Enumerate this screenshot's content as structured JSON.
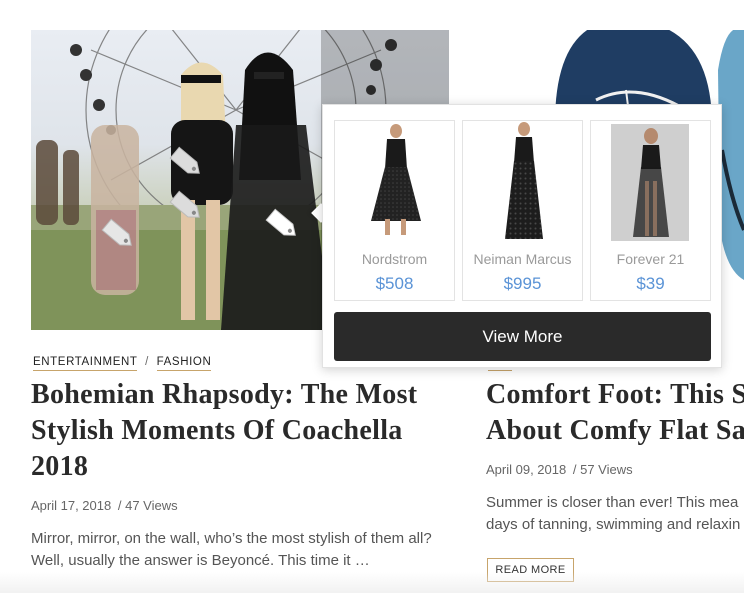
{
  "left_article": {
    "categories": [
      "ENTERTAINMENT",
      "FASHION"
    ],
    "category_separator": "/",
    "title": "Bohemian Rhapsody: The Most Stylish Moments Of Coachella 2018",
    "date": "April 17, 2018",
    "views": "/ 47 Views",
    "excerpt": "Mirror, mirror, on the wall, who’s the most stylish of them all? Well, usually the answer is Beyoncé. This time it …"
  },
  "right_article": {
    "title": "Comfort Foot: This S",
    "title_line2": "About Comfy Flat Sa",
    "date": "April 09, 2018",
    "views": "/ 57 Views",
    "excerpt_line1": "Summer is closer than ever! This mea",
    "excerpt_line2": "days of tanning, swimming and relaxin",
    "read_more_label": "READ MORE"
  },
  "popover": {
    "products": [
      {
        "store": "Nordstrom",
        "price": "$508"
      },
      {
        "store": "Neiman Marcus",
        "price": "$995"
      },
      {
        "store": "Forever 21",
        "price": "$39"
      }
    ],
    "view_more_label": "View More"
  },
  "colors": {
    "accent_gold": "#c7a46b",
    "price_blue": "#5a93d6",
    "button_dark": "#2a2a2a"
  },
  "icons": [
    "price-tag-icon"
  ]
}
